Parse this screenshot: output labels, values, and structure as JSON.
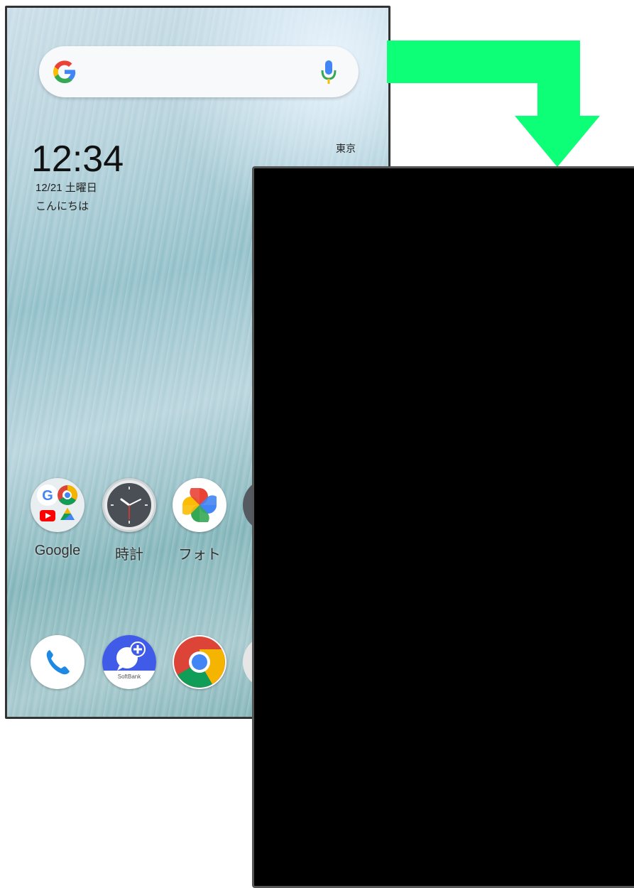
{
  "home_screen": {
    "search": {
      "placeholder": ""
    },
    "clock": {
      "time": "12:34",
      "date": "12/21 土曜日",
      "greeting": "こんにちは"
    },
    "weather": {
      "city": "東京"
    },
    "apps_row": [
      {
        "label": "Google",
        "icon": "google-folder-icon"
      },
      {
        "label": "時計",
        "icon": "clock-icon"
      },
      {
        "label": "フォト",
        "icon": "photos-icon"
      }
    ],
    "dock": [
      {
        "icon": "phone-icon"
      },
      {
        "icon": "softbank-message-plus-icon",
        "sublabel": "SoftBank"
      },
      {
        "icon": "chrome-icon"
      }
    ]
  },
  "overlay": {
    "arrow_color": "#0CFF77",
    "panel_color": "#000000"
  }
}
